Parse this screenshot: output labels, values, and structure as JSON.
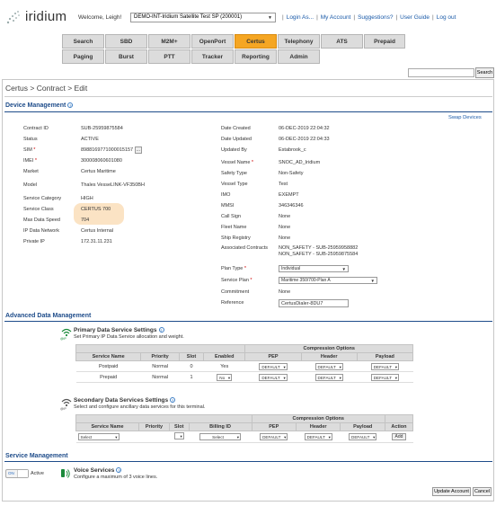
{
  "header": {
    "logo_text": "iridium",
    "welcome": "Welcome, Leigh!",
    "account_selected": "DEMO-INT-Iridium Satellite Test SP (200001)",
    "links": [
      "Login As...",
      "My Account",
      "Suggestions?",
      "User Guide",
      "Log out"
    ]
  },
  "nav": {
    "row1": [
      "Search",
      "SBD",
      "M2M+",
      "OpenPort",
      "Certus",
      "Telephony",
      "ATS",
      "Prepaid"
    ],
    "row2": [
      "Paging",
      "Burst",
      "PTT",
      "Tracker",
      "Reporting",
      "Admin"
    ],
    "active": "Certus"
  },
  "search": {
    "button": "Search",
    "value": ""
  },
  "breadcrumb": "Certus > Contract > Edit",
  "device_management": {
    "title": "Device Management",
    "swap_devices": "Swap Devices",
    "left": {
      "contract_id": {
        "label": "Contract ID",
        "value": "SUB-25959875584"
      },
      "status": {
        "label": "Status",
        "value": "ACTIVE"
      },
      "sim": {
        "label": "SIM",
        "value": "8988169771000015157",
        "extra": "..."
      },
      "imei": {
        "label": "IMEI",
        "value": "300008060601080"
      },
      "market": {
        "label": "Market",
        "value": "Certus Maritime"
      },
      "model": {
        "label": "Model",
        "value": "Thales VesseLINK-VF350BH"
      },
      "service_category": {
        "label": "Service Category",
        "value": "HIGH"
      },
      "service_class": {
        "label": "Service Class",
        "value": "CERTUS 700"
      },
      "max_data_speed": {
        "label": "Max Data Speed",
        "value": "704"
      },
      "ip_data_network": {
        "label": "IP Data Network",
        "value": "Certus Internal"
      },
      "private_ip": {
        "label": "Private IP",
        "value": "172.31.11.231"
      }
    },
    "right": {
      "date_created": {
        "label": "Date Created",
        "value": "06-DEC-2019 22:04:32"
      },
      "date_updated": {
        "label": "Date Updated",
        "value": "06-DEC-2019 22:04:33"
      },
      "updated_by": {
        "label": "Updated By",
        "value": "Estabrook_c"
      },
      "vessel_name": {
        "label": "Vessel Name",
        "value": "SNOC_AD_Iridium"
      },
      "safety_type": {
        "label": "Safety Type",
        "value": "Non-Safety"
      },
      "vessel_type": {
        "label": "Vessel Type",
        "value": "Test"
      },
      "imo": {
        "label": "IMO",
        "value": "EXEMPT"
      },
      "mmsi": {
        "label": "MMSI",
        "value": "346346346"
      },
      "call_sign": {
        "label": "Call Sign",
        "value": "None"
      },
      "fleet_name": {
        "label": "Fleet Name",
        "value": "None"
      },
      "ship_registry": {
        "label": "Ship Registry",
        "value": "None"
      },
      "associated_contracts": {
        "label": "Associated Contracts",
        "value1": "NON_SAFETY - SUB-25959958882",
        "value2": "NON_SAFETY - SUB-25959875584"
      },
      "plan_type": {
        "label": "Plan Type",
        "value": "Individual"
      },
      "service_plan": {
        "label": "Service Plan",
        "value": "Maritime 350/700-Plan A"
      },
      "commitment": {
        "label": "Commitment",
        "value": "None"
      },
      "reference": {
        "label": "Reference",
        "value": "CertusDialer-8DU7"
      }
    }
  },
  "advanced": {
    "title": "Advanced Data Management",
    "primary": {
      "title": "Primary Data Service Settings",
      "subtitle": "Set Primary IP Data Service allocation and weight.",
      "icon_caption": "@IP",
      "group_header": "Compression Options",
      "headers": [
        "Service Name",
        "Priority",
        "Slot",
        "Enabled",
        "PEP",
        "Header",
        "Payload"
      ],
      "rows": [
        {
          "service": "Postpaid",
          "priority": "Normal",
          "slot": "0",
          "enabled": "Yes",
          "pep": "DEFAULT",
          "header": "DEFAULT",
          "payload": "DEFAULT"
        },
        {
          "service": "Prepaid",
          "priority": "Normal",
          "slot": "1",
          "enabled": "No",
          "pep": "DEFAULT",
          "header": "DEFAULT",
          "payload": "DEFAULT"
        }
      ]
    },
    "secondary": {
      "title": "Secondary Data Services Settings",
      "subtitle": "Select and configure ancillary data services for this terminal.",
      "icon_caption": "@IP",
      "group_header": "Compression Options",
      "headers": [
        "Service Name",
        "Priority",
        "Slot",
        "Billing ID",
        "PEP",
        "Header",
        "Payload",
        "Action"
      ],
      "row": {
        "service": "Select",
        "billing": "Select",
        "pep": "DEFAULT",
        "header": "DEFAULT",
        "payload": "DEFAULT",
        "action": "Add"
      }
    }
  },
  "service_management": {
    "title": "Service Management",
    "toggle_label": "ON",
    "status": "Active",
    "voice_title": "Voice Services",
    "voice_subtitle": "Configure a maximum of 3 voice lines."
  },
  "footer": {
    "update": "Update Account",
    "cancel": "Cancel"
  },
  "colors": {
    "accent": "#f5a623",
    "link": "#1a5aa8",
    "section": "#1e4c8a",
    "highlight": "#fbe3c4"
  }
}
